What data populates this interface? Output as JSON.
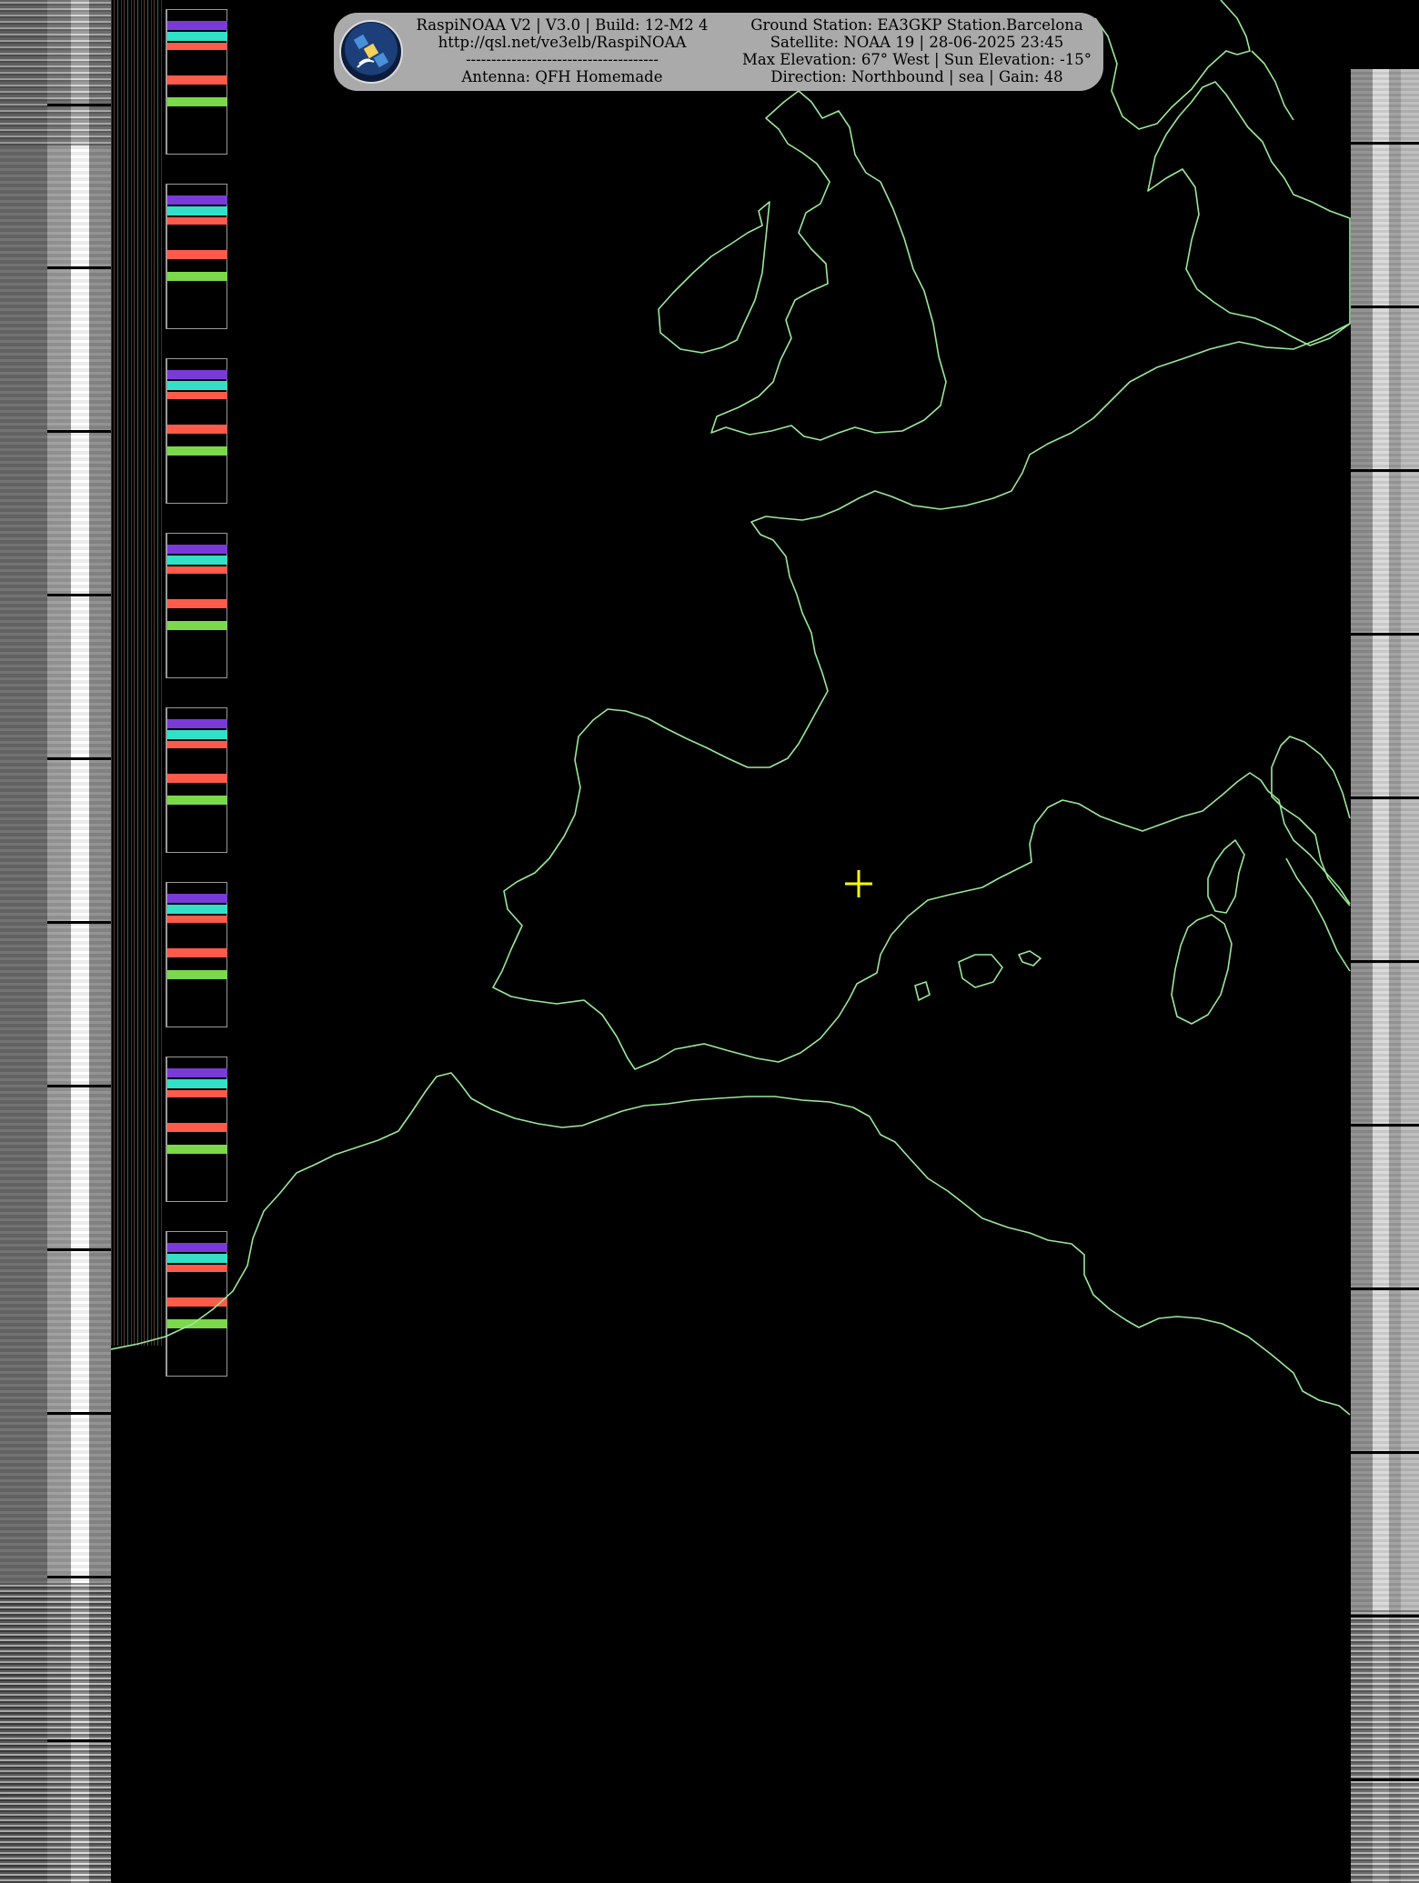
{
  "banner": {
    "left_lines": [
      "RaspiNOAA V2 | V3.0 | Build: 12-M2 4",
      "http://qsl.net/ve3elb/RaspiNOAA",
      "--------------------------------------",
      "Antenna: QFH Homemade"
    ],
    "right_lines": [
      "Ground Station: EA3GKP Station.Barcelona",
      "Satellite: NOAA 19 | 28-06-2025 23:45",
      "Max Elevation: 67° West | Sun Elevation: -15°",
      "Direction: Northbound | sea | Gain: 48"
    ]
  },
  "icons": {
    "logo": "satellite-icon",
    "marker": "ground-station-crosshair-icon"
  },
  "colors": {
    "coastline": "#9be89b",
    "marker": "#ffff00",
    "banner": "#aaaaaa",
    "background": "#000000"
  }
}
